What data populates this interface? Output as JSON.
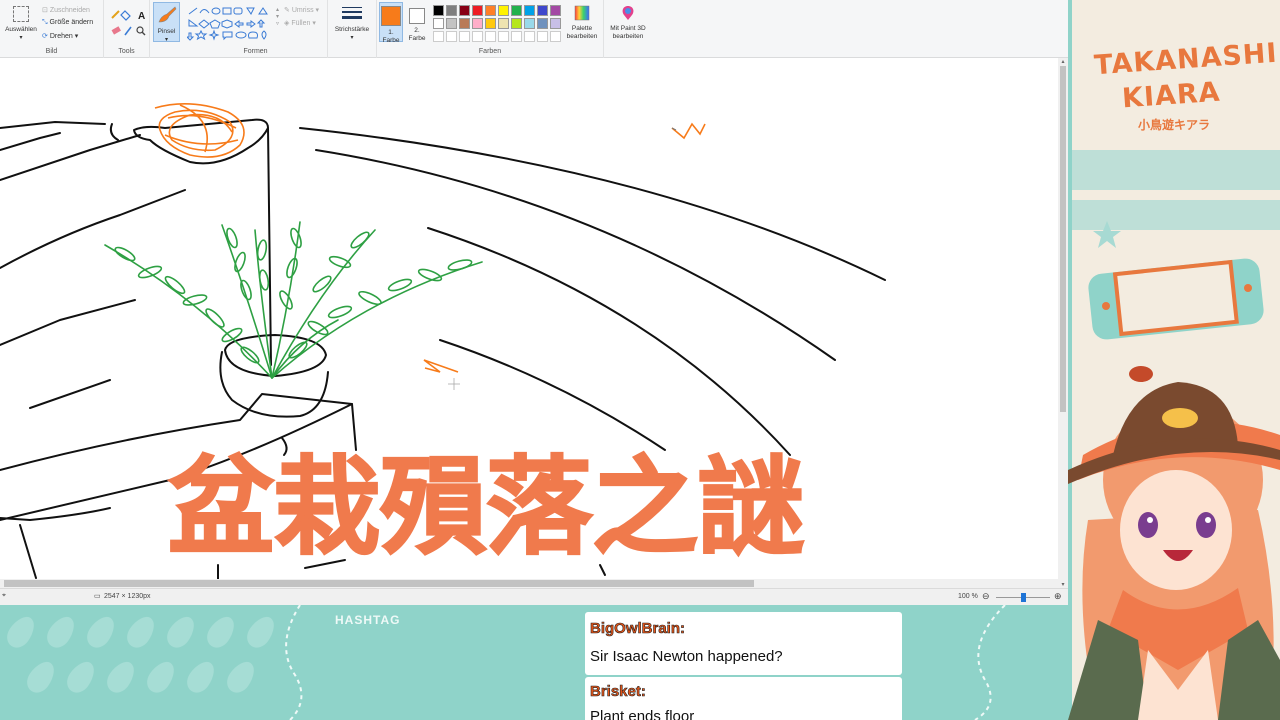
{
  "ribbon": {
    "bild": {
      "label": "Bild",
      "select_label": "Auswählen",
      "crop": "Zuschneiden",
      "resize": "Größe ändern",
      "rotate": "Drehen"
    },
    "tools": {
      "label": "Tools",
      "text_tool": "A"
    },
    "brush": {
      "label": "Pinsel"
    },
    "shapes": {
      "label": "Formen",
      "outline": "Umriss",
      "fill": "Füllen"
    },
    "stroke": {
      "label": "Strichstärke"
    },
    "colors": {
      "label": "Farben",
      "color1_label": "1.",
      "color1_sub": "Farbe",
      "color2_label": "2.",
      "color2_sub": "Farbe",
      "color1_value": "#f77b1a",
      "color2_value": "#ffffff",
      "palette_row1": [
        "#000000",
        "#7f7f7f",
        "#880015",
        "#ed1c24",
        "#ff7f27",
        "#fff200",
        "#22b14c",
        "#00a2e8",
        "#3f48cc",
        "#a349a4"
      ],
      "palette_row2": [
        "#ffffff",
        "#c3c3c3",
        "#b97a57",
        "#ffaec9",
        "#ffc90e",
        "#efe4b0",
        "#b5e61d",
        "#99d9ea",
        "#7092be",
        "#c8bfe7"
      ],
      "edit_palette_1": "Palette",
      "edit_palette_2": "bearbeiten",
      "paint3d_1": "Mit Paint 3D",
      "paint3d_2": "bearbeiten"
    }
  },
  "statusbar": {
    "dimensions": "2547 × 1230px",
    "zoom": "100 %",
    "zoom_level": 0.5
  },
  "overlay": {
    "title": "盆栽殞落之謎",
    "hashtag": "HASHTAG",
    "logo_line1": "TAKANASHI",
    "logo_line2": "KIARA",
    "logo_jp": "小鳥遊キアラ"
  },
  "chat": [
    {
      "name": "BigOwlBrain:",
      "message": "Sir Isaac Newton happened?"
    },
    {
      "name": "Brisket:",
      "message": "Plant ends floor"
    }
  ],
  "colors": {
    "accent_orange": "#f07a4c",
    "teal": "#8fd3c9",
    "plant_green": "#2ea043",
    "brush_orange": "#f77b1a"
  }
}
